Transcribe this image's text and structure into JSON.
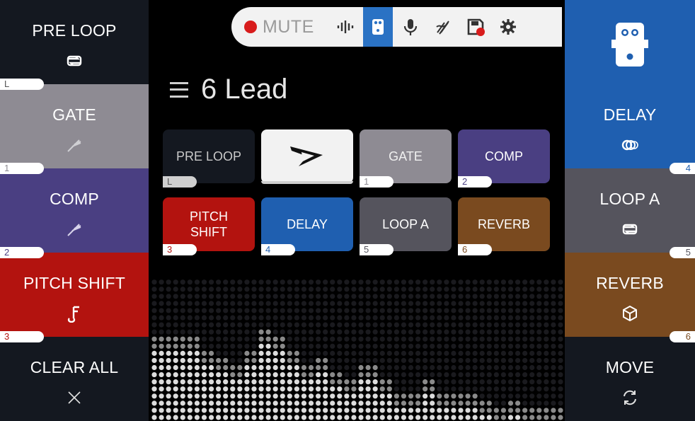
{
  "colors": {
    "pre_loop": "#141820",
    "gate": "#8e8b93",
    "comp": "#4a3f82",
    "pitch_shift": "#b3130f",
    "clear_all": "#141820",
    "amp_selected": "#1f5fb0",
    "delay": "#1f5fb0",
    "loop_a": "#55545d",
    "reverb": "#7a4a1f",
    "move": "#141820",
    "accent": "#2a72c4"
  },
  "topbar": {
    "mute_label": "MUTE",
    "icons": [
      "level-meter-icon",
      "effects-pedal-icon",
      "microphone-icon",
      "tuning-fork-icon",
      "save-icon",
      "settings-gear-icon"
    ]
  },
  "preset": {
    "name": "6 Lead"
  },
  "left_slots": [
    {
      "label": "PRE LOOP",
      "icon": "loop-icon",
      "badge": "L"
    },
    {
      "label": "GATE",
      "icon": "gate-icon",
      "badge": "1"
    },
    {
      "label": "COMP",
      "icon": "compressor-icon",
      "badge": "2"
    },
    {
      "label": "PITCH SHIFT",
      "icon": "pitch-note-icon",
      "badge": "3"
    },
    {
      "label": "CLEAR ALL",
      "icon": "close-icon"
    }
  ],
  "right_slots": [
    {
      "label": "",
      "icon": "effects-pedal-icon"
    },
    {
      "label": "DELAY",
      "icon": "delay-rings-icon",
      "badge": "4"
    },
    {
      "label": "LOOP A",
      "icon": "loop-icon",
      "badge": "5"
    },
    {
      "label": "REVERB",
      "icon": "reverb-cube-icon",
      "badge": "6"
    },
    {
      "label": "MOVE",
      "icon": "move-refresh-icon"
    }
  ],
  "grid": [
    {
      "label": "PRE LOOP",
      "badge": "L"
    },
    {
      "label": "",
      "icon": "amp-logo-icon"
    },
    {
      "label": "GATE",
      "badge": "1"
    },
    {
      "label": "COMP",
      "badge": "2"
    },
    {
      "label": "PITCH\nSHIFT",
      "badge": "3"
    },
    {
      "label": "DELAY",
      "badge": "4"
    },
    {
      "label": "LOOP A",
      "badge": "5"
    },
    {
      "label": "REVERB",
      "badge": "6"
    }
  ],
  "visualizer_levels": [
    0.62,
    0.62,
    0.58,
    0.5,
    0.44,
    0.38,
    0.52,
    0.64,
    0.6,
    0.5,
    0.4,
    0.46,
    0.34,
    0.3,
    0.4,
    0.3,
    0.22,
    0.2,
    0.3,
    0.22,
    0.18,
    0.22,
    0.16,
    0.12,
    0.14,
    0.08,
    0.1,
    0.08
  ]
}
